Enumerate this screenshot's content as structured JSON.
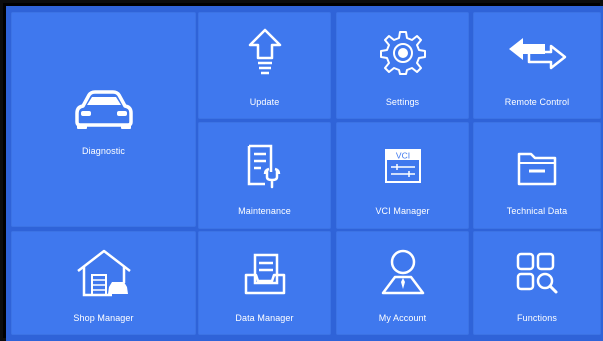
{
  "tiles": {
    "diagnostic": {
      "label": "Diagnostic",
      "icon": "car-front-icon"
    },
    "update": {
      "label": "Update",
      "icon": "up-arrow-icon"
    },
    "settings": {
      "label": "Settings",
      "icon": "gear-icon"
    },
    "remote_control": {
      "label": "Remote Control",
      "icon": "two-way-arrows-icon"
    },
    "maintenance": {
      "label": "Maintenance",
      "icon": "document-wrench-icon"
    },
    "vci_manager": {
      "label": "VCI Manager",
      "icon": "vci-device-icon",
      "badge": "VCI"
    },
    "technical_data": {
      "label": "Technical Data",
      "icon": "folder-icon"
    },
    "shop_manager": {
      "label": "Shop Manager",
      "icon": "garage-car-icon"
    },
    "data_manager": {
      "label": "Data Manager",
      "icon": "document-tray-icon"
    },
    "my_account": {
      "label": "My Account",
      "icon": "user-icon"
    },
    "functions": {
      "label": "Functions",
      "icon": "grid-search-icon"
    }
  },
  "colors": {
    "background": "#2f63d8",
    "tile": "#3f78ee",
    "icon": "#ffffff",
    "frame": "#0c0c0c"
  }
}
